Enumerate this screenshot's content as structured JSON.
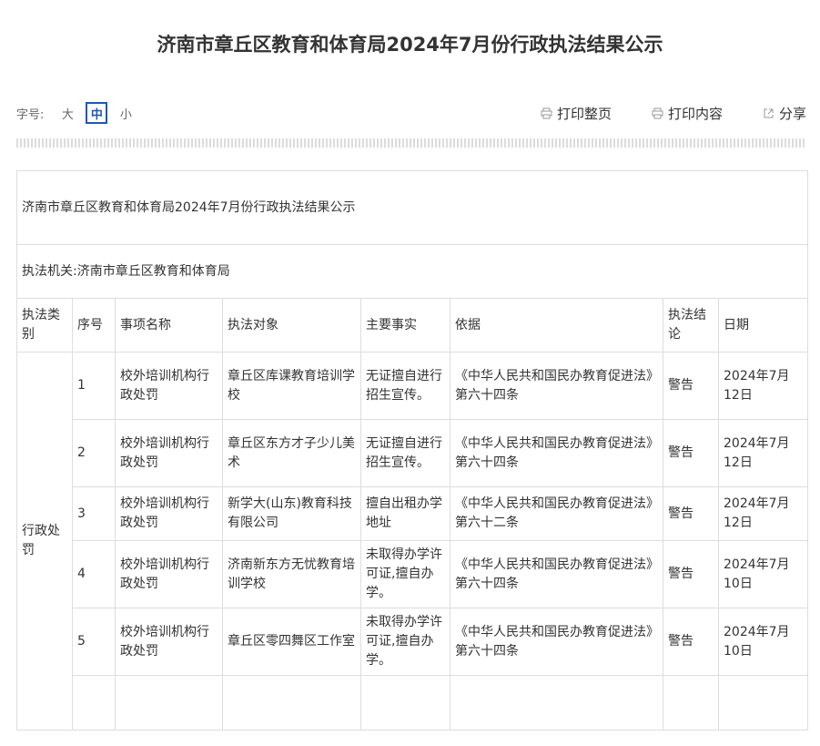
{
  "page_title": "济南市章丘区教育和体育局2024年7月份行政执法结果公示",
  "font_size_ctrl": {
    "label": "字号:",
    "options": [
      "大",
      "中",
      "小"
    ],
    "selected": "中"
  },
  "actions": {
    "print_page": "打印整页",
    "print_content": "打印内容",
    "share": "分享"
  },
  "notice": {
    "title": "济南市章丘区教育和体育局2024年7月份行政执法结果公示",
    "agency": "执法机关:济南市章丘区教育和体育局",
    "headers": [
      "执法类别",
      "序号",
      "事项名称",
      "执法对象",
      "主要事实",
      "依据",
      "执法结论",
      "日期"
    ],
    "category": "行政处罚",
    "rows": [
      {
        "no": "1",
        "item": "校外培训机构行政处罚",
        "target": "章丘区库课教育培训学校",
        "fact": "无证擅自进行招生宣传。",
        "basis": "《中华人民共和国民办教育促进法》第六十四条",
        "conclusion": "警告",
        "date": "2024年7月12日"
      },
      {
        "no": "2",
        "item": "校外培训机构行政处罚",
        "target": "章丘区东方才子少儿美术",
        "fact": "无证擅自进行招生宣传。",
        "basis": "《中华人民共和国民办教育促进法》第六十四条",
        "conclusion": "警告",
        "date": "2024年7月12日"
      },
      {
        "no": "3",
        "item": "校外培训机构行政处罚",
        "target": "新学大(山东)教育科技有限公司",
        "fact": "擅自出租办学地址",
        "basis": "《中华人民共和国民办教育促进法》第六十二条",
        "conclusion": "警告",
        "date": "2024年7月12日"
      },
      {
        "no": "4",
        "item": "校外培训机构行政处罚",
        "target": "济南新东方无忧教育培训学校",
        "fact": "未取得办学许可证,擅自办学。",
        "basis": "《中华人民共和国民办教育促进法》第六十四条",
        "conclusion": "警告",
        "date": "2024年7月10日"
      },
      {
        "no": "5",
        "item": "校外培训机构行政处罚",
        "target": "章丘区零四舞区工作室",
        "fact": "未取得办学许可证,擅自办学。",
        "basis": "《中华人民共和国民办教育促进法》第六十四条",
        "conclusion": "警告",
        "date": "2024年7月10日"
      }
    ]
  },
  "colors": {
    "accent": "#1e58b6",
    "text": "#333333",
    "border": "#dddddd"
  },
  "icons": {
    "print": "printer-icon",
    "share": "share-icon"
  }
}
